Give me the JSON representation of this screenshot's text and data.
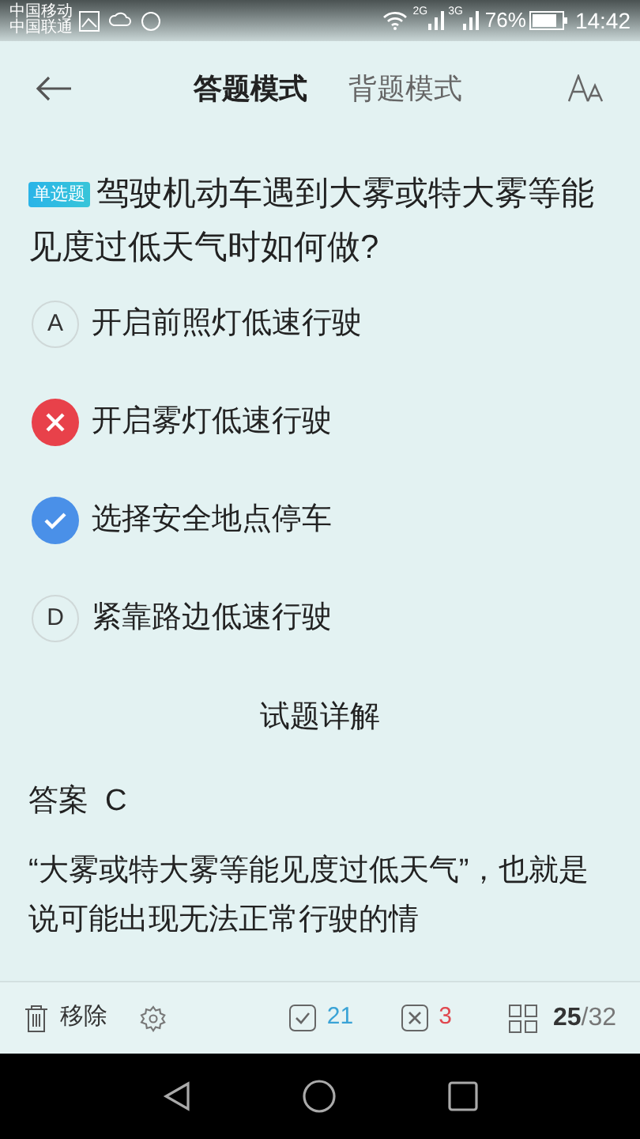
{
  "status_bar": {
    "carrier_1": "中国移动",
    "carrier_2": "中国联通",
    "signal_1": "2G",
    "signal_2": "3G",
    "battery": "76%",
    "time": "14:42"
  },
  "header": {
    "tabs": [
      {
        "label": "答题模式",
        "selected": true
      },
      {
        "label": "背题模式",
        "selected": false
      }
    ]
  },
  "question": {
    "badge": "单选题",
    "text": "驾驶机动车遇到大雾或特大雾等能见度过低天气时如何做?"
  },
  "options": [
    {
      "kind": "letter",
      "letter": "A",
      "text": "开启前照灯低速行驶"
    },
    {
      "kind": "wrong",
      "text": "开启雾灯低速行驶"
    },
    {
      "kind": "correct",
      "text": "选择安全地点停车"
    },
    {
      "kind": "letter",
      "letter": "D",
      "text": "紧靠路边低速行驶"
    }
  ],
  "details": {
    "title": "试题详解",
    "answer": "答案  C",
    "explanation": "“大雾或特大雾等能见度过低天气”，也就是说可能出现无法正常行驶的情"
  },
  "bottom_bar": {
    "remove": "移除",
    "correct_count": "21",
    "wrong_count": "3",
    "current": "25",
    "total": "/32"
  }
}
